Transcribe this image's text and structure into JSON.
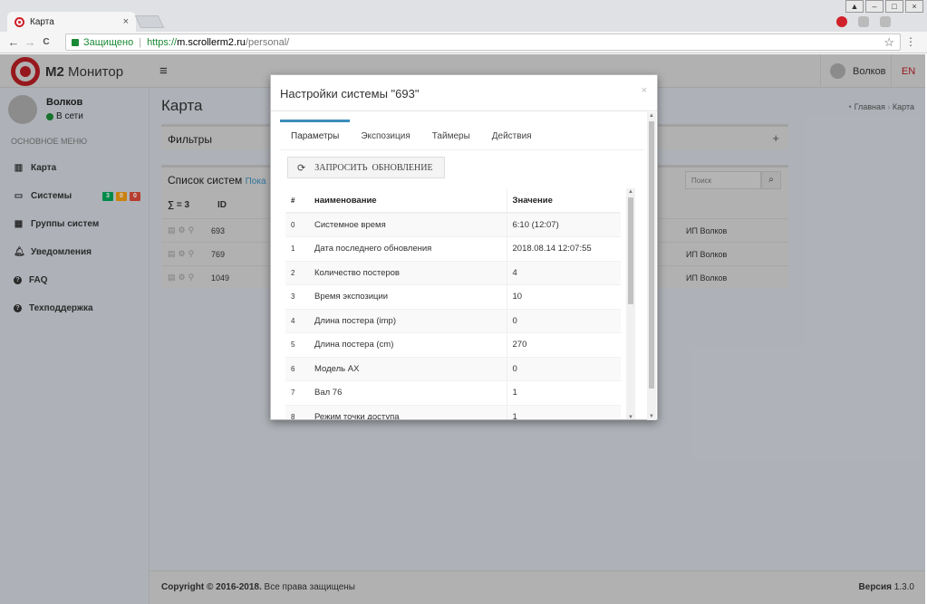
{
  "browser": {
    "tab_title": "Карта",
    "tab_close": "×",
    "secure_label": "Защищено",
    "url_proto": "https://",
    "url_host": "m.scrollerm2.ru",
    "url_path": "/personal/",
    "star": "☆",
    "menu": "⋮",
    "back": "←",
    "forward": "→",
    "reload": "C"
  },
  "header": {
    "brand_bold": "M2",
    "brand_rest": " Монитор",
    "menu_toggle": "≡",
    "user_name": "Волков",
    "lang": "EN"
  },
  "sidebar": {
    "user_name": "Волков",
    "status": "В сети",
    "menu_header": "ОСНОВНОЕ МЕНЮ",
    "items": [
      {
        "label": "Карта",
        "icon": "map-icon",
        "glyph": "▥"
      },
      {
        "label": "Системы",
        "icon": "monitor-icon",
        "glyph": "▭"
      },
      {
        "label": "Группы систем",
        "icon": "groups-icon",
        "glyph": "▦"
      },
      {
        "label": "Уведомления",
        "icon": "bell-icon",
        "glyph": "♫"
      },
      {
        "label": "FAQ",
        "icon": "question-icon",
        "glyph": "?"
      },
      {
        "label": "Техподдержка",
        "icon": "support-icon",
        "glyph": "?"
      }
    ],
    "system_badges": [
      {
        "value": "3",
        "color": "#00a65a"
      },
      {
        "value": "0",
        "color": "#f39c12"
      },
      {
        "value": "0",
        "color": "#dd4b39"
      }
    ]
  },
  "content": {
    "page_title": "Карта",
    "breadcrumb_home": "Главная",
    "breadcrumb_sep": "›",
    "breadcrumb_current": "Карта",
    "filters_title": "Фильтры",
    "filters_toggle": "+",
    "list_title": "Список систем",
    "list_link": "Пока",
    "search_placeholder": "Поиск",
    "list_sum": "∑ = 3",
    "list_col_id": "ID",
    "rows": [
      {
        "id": "693",
        "owner": "ИП Волков"
      },
      {
        "id": "769",
        "owner": "ИП Волков"
      },
      {
        "id": "1049",
        "owner": "ИП Волков"
      }
    ]
  },
  "footer": {
    "copyright_bold": "Copyright © 2016-2018.",
    "copyright_rest": " Все права защищены",
    "version_bold": "Версия",
    "version_value": " 1.3.0"
  },
  "modal": {
    "title": "Настройки системы \"693\"",
    "close": "×",
    "tabs": [
      "Параметры",
      "Экспозиция",
      "Таймеры",
      "Действия"
    ],
    "active_tab": 0,
    "refresh_label": "ЗАПРОСИТЬ  ОБНОВЛЕНИЕ",
    "columns": [
      "#",
      "наименование",
      "Значение"
    ],
    "rows": [
      {
        "n": "0",
        "name": "Системное время",
        "value": "6:10 (12:07)"
      },
      {
        "n": "1",
        "name": "Дата последнего обновления",
        "value": "2018.08.14 12:07:55"
      },
      {
        "n": "2",
        "name": "Количество постеров",
        "value": "4"
      },
      {
        "n": "3",
        "name": "Время экспозиции",
        "value": "10"
      },
      {
        "n": "4",
        "name": "Длина постера (imp)",
        "value": "0"
      },
      {
        "n": "5",
        "name": "Длина постера (cm)",
        "value": "270"
      },
      {
        "n": "6",
        "name": "Модель АХ",
        "value": "0"
      },
      {
        "n": "7",
        "name": "Вал 76",
        "value": "1"
      },
      {
        "n": "8",
        "name": "Режим точки доступа",
        "value": "1"
      }
    ]
  }
}
